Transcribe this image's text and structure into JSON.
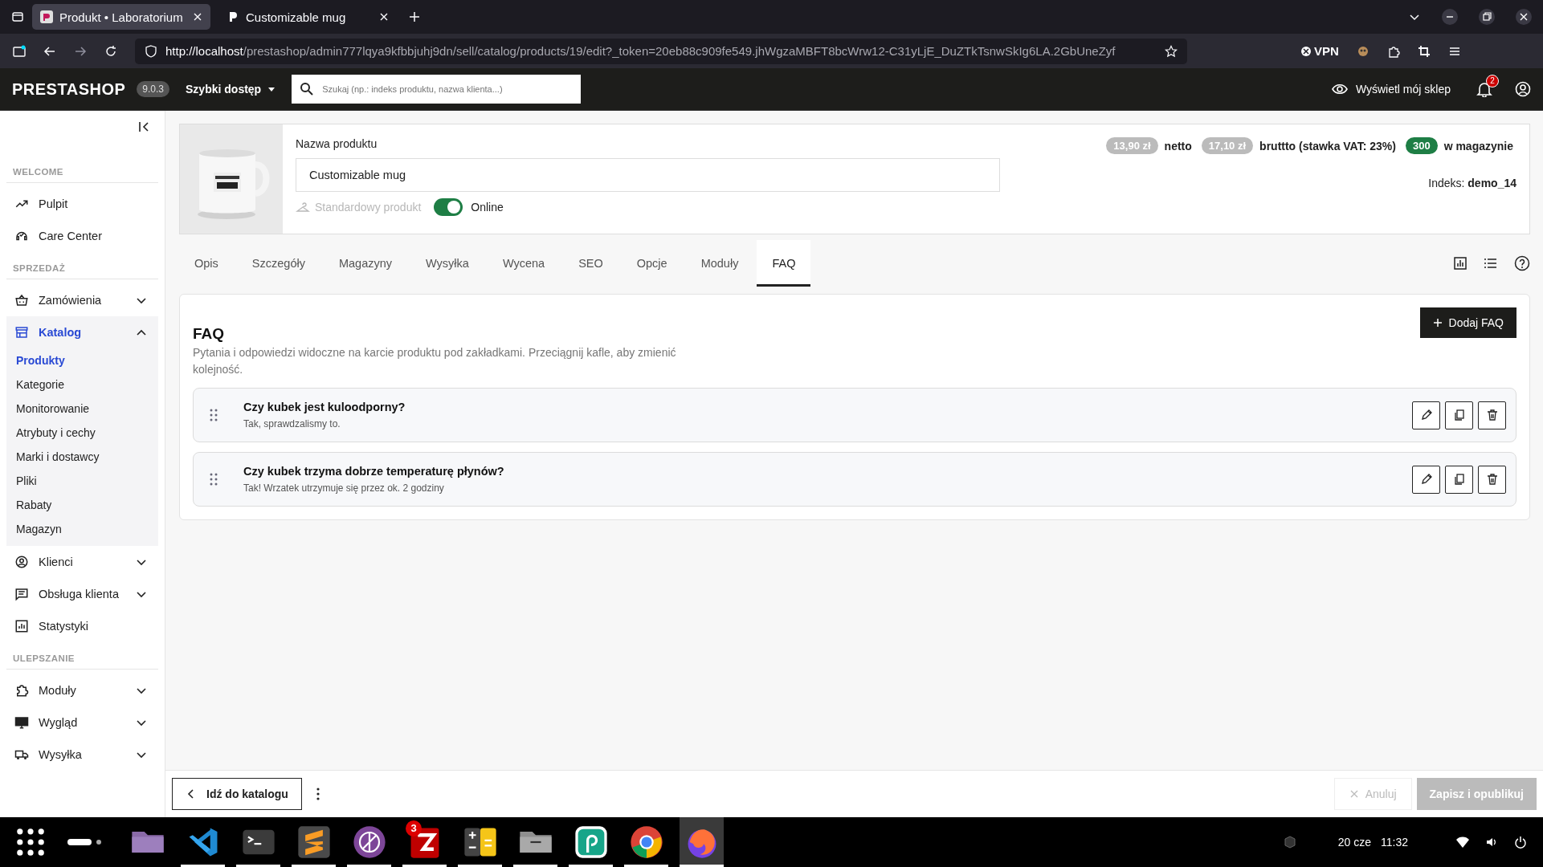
{
  "browser": {
    "tabs": [
      {
        "title": "Produkt • Laboratorium",
        "selected": true
      },
      {
        "title": "Customizable mug",
        "selected": false
      }
    ],
    "url": {
      "host": "http://localhost",
      "path": "/prestashop/admin777lqya9kfbbjuhj9dn/sell/catalog/products/19/edit?_token=20eb88c909fe549.jhWgzaMBFT8bcWrw12-C31yLjE_DuZTkTsnwSkIg6LA.2GbUneZyf"
    },
    "vpn": "VPN"
  },
  "header": {
    "logo": "PRESTASHOP",
    "version": "9.0.3",
    "quick_access": "Szybki dostęp",
    "search": {
      "placeholder": "Szukaj (np.: indeks produktu, nazwa klienta...)"
    },
    "view_shop": "Wyświetl mój sklep",
    "notifications": "2"
  },
  "sidebar": {
    "groups": [
      {
        "title": "WELCOME",
        "items": [
          {
            "label": "Pulpit",
            "selected": false
          },
          {
            "label": "Care Center",
            "selected": false
          }
        ]
      },
      {
        "title": "SPRZEDAŻ",
        "items": [
          {
            "label": "Zamówienia",
            "expanded": false,
            "selected": false
          },
          {
            "label": "Katalog",
            "expanded": true,
            "selected": true,
            "children": [
              {
                "label": "Produkty",
                "selected": true
              },
              {
                "label": "Kategorie",
                "selected": false
              },
              {
                "label": "Monitorowanie",
                "selected": false
              },
              {
                "label": "Atrybuty i cechy",
                "selected": false
              },
              {
                "label": "Marki i dostawcy",
                "selected": false
              },
              {
                "label": "Pliki",
                "selected": false
              },
              {
                "label": "Rabaty",
                "selected": false
              },
              {
                "label": "Magazyn",
                "selected": false
              }
            ]
          },
          {
            "label": "Klienci",
            "expanded": false,
            "selected": false
          },
          {
            "label": "Obsługa klienta",
            "expanded": false,
            "selected": false
          },
          {
            "label": "Statystyki",
            "selected": false
          }
        ]
      },
      {
        "title": "ULEPSZANIE",
        "items": [
          {
            "label": "Moduły",
            "expanded": false,
            "selected": false
          },
          {
            "label": "Wygląd",
            "expanded": false,
            "selected": false
          },
          {
            "label": "Wysyłka",
            "expanded": false,
            "selected": false
          }
        ]
      }
    ]
  },
  "product": {
    "name_label": "Nazwa produktu",
    "name": "Customizable mug",
    "type": "Standardowy produkt",
    "online": true,
    "online_label": "Online",
    "price_net": "13,90 zł",
    "net_label": "netto",
    "price_gross": "17,10 zł",
    "gross_label": "bruttto (stawka VAT: 23%)",
    "stock": "300",
    "stock_label": "w magazynie",
    "reference_label": "Indeks:",
    "reference": "demo_14"
  },
  "tabs": [
    {
      "label": "Opis",
      "selected": false
    },
    {
      "label": "Szczegóły",
      "selected": false
    },
    {
      "label": "Magazyny",
      "selected": false
    },
    {
      "label": "Wysyłka",
      "selected": false
    },
    {
      "label": "Wycena",
      "selected": false
    },
    {
      "label": "SEO",
      "selected": false
    },
    {
      "label": "Opcje",
      "selected": false
    },
    {
      "label": "Moduły",
      "selected": false
    },
    {
      "label": "FAQ",
      "selected": true
    }
  ],
  "faq": {
    "title": "FAQ",
    "description": "Pytania i odpowiedzi widoczne na karcie produktu pod zakładkami. Przeciągnij kafle, aby zmienić kolejność.",
    "add_button": "Dodaj FAQ",
    "items": [
      {
        "question": "Czy kubek jest kuloodporny?",
        "answer": "Tak, sprawdzalismy to."
      },
      {
        "question": "Czy kubek trzyma dobrze temperaturę płynów?",
        "answer": "Tak! Wrzatek utrzymuje się przez ok. 2 godziny"
      }
    ]
  },
  "footer": {
    "back": "Idź do katalogu",
    "cancel": "Anuluj",
    "cancel_disabled": true,
    "save": "Zapisz i opublikuj",
    "save_disabled": true
  },
  "taskbar": {
    "apps": [
      {
        "running": false,
        "active": false
      },
      {
        "running": true,
        "active": false
      },
      {
        "running": true,
        "active": false
      },
      {
        "running": true,
        "active": false
      },
      {
        "running": true,
        "active": false
      },
      {
        "running": true,
        "active": false,
        "badge": "3"
      },
      {
        "running": true,
        "active": false
      },
      {
        "running": true,
        "active": false
      },
      {
        "running": true,
        "active": false
      },
      {
        "running": true,
        "active": false
      },
      {
        "running": true,
        "active": true
      }
    ],
    "date": "20 cze",
    "time": "11:32"
  }
}
